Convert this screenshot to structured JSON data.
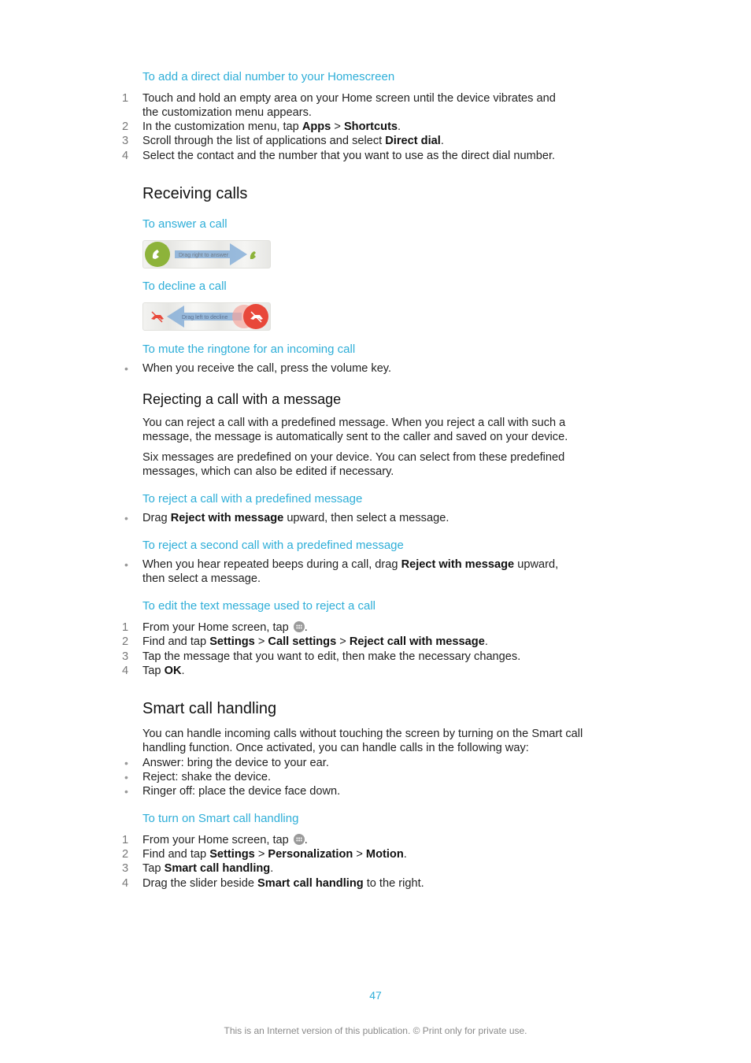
{
  "direct_dial": {
    "heading": "To add a direct dial number to your Homescreen",
    "steps": [
      {
        "n": "1",
        "line1": "Touch and hold an empty area on your Home screen until the device vibrates and",
        "line2": "the customization menu appears."
      },
      {
        "n": "2",
        "pre": "In the customization menu, tap ",
        "b1": "Apps",
        "sep": " > ",
        "b2": "Shortcuts",
        "post": "."
      },
      {
        "n": "3",
        "pre": "Scroll through the list of applications and select ",
        "b1": "Direct dial",
        "post": "."
      },
      {
        "n": "4",
        "text": "Select the contact and the number that you want to use as the direct dial number."
      }
    ]
  },
  "receiving": {
    "title": "Receiving calls",
    "answer_heading": "To answer a call",
    "answer_slider_label": "Drag right to answer",
    "answer_color": "#8db33a",
    "decline_heading": "To decline a call",
    "decline_slider_label": "Drag left to decline",
    "decline_color": "#e8483a",
    "mute_heading": "To mute the ringtone for an incoming call",
    "mute_bullet": "When you receive the call, press the volume key."
  },
  "rejecting": {
    "title": "Rejecting a call with a message",
    "para1_line1": "You can reject a call with a predefined message. When you reject a call with such a",
    "para1_line2": "message, the message is automatically sent to the caller and saved on your device.",
    "para2_line1": "Six messages are predefined on your device. You can select from these predefined",
    "para2_line2": "messages, which can also be edited if necessary.",
    "predefined_heading": "To reject a call with a predefined message",
    "predefined_bullet": {
      "pre": "Drag ",
      "b": "Reject with message",
      "post": " upward, then select a message."
    },
    "second_heading": "To reject a second call with a predefined message",
    "second_bullet": {
      "pre": "When you hear repeated beeps during a call, drag ",
      "b": "Reject with message",
      "post": " upward,",
      "line2": "then select a message."
    },
    "edit_heading": "To edit the text message used to reject a call",
    "edit_steps": [
      {
        "n": "1",
        "pre": "From your Home screen, tap ",
        "post": "."
      },
      {
        "n": "2",
        "pre": "Find and tap ",
        "b1": "Settings",
        "sep1": " > ",
        "b2": "Call settings",
        "sep2": " > ",
        "b3": "Reject call with message",
        "post": "."
      },
      {
        "n": "3",
        "text": "Tap the message that you want to edit, then make the necessary changes."
      },
      {
        "n": "4",
        "pre": "Tap ",
        "b1": "OK",
        "post": "."
      }
    ]
  },
  "smart": {
    "title": "Smart call handling",
    "para_line1": "You can handle incoming calls without touching the screen by turning on the Smart call",
    "para_line2": "handling function. Once activated, you can handle calls in the following way:",
    "bullets": [
      "Answer: bring the device to your ear.",
      "Reject: shake the device.",
      "Ringer off: place the device face down."
    ],
    "turn_on_heading": "To turn on Smart call handling",
    "steps": [
      {
        "n": "1",
        "pre": "From your Home screen, tap ",
        "post": "."
      },
      {
        "n": "2",
        "pre": "Find and tap ",
        "b1": "Settings",
        "sep1": " > ",
        "b2": "Personalization",
        "sep2": " > ",
        "b3": "Motion",
        "post": "."
      },
      {
        "n": "3",
        "pre": "Tap ",
        "b1": "Smart call handling",
        "post": "."
      },
      {
        "n": "4",
        "pre": "Drag the slider beside ",
        "b1": "Smart call handling",
        "post": " to the right."
      }
    ]
  },
  "footer": {
    "page_number": "47",
    "note": "This is an Internet version of this publication. © Print only for private use."
  }
}
